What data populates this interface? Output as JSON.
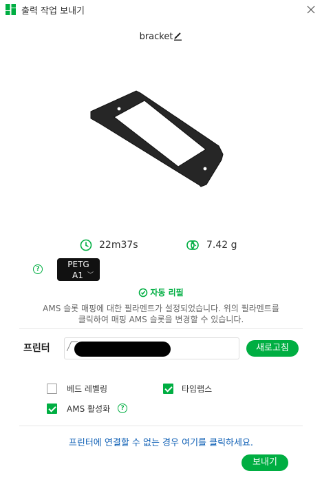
{
  "window": {
    "title": "출력 작업 보내기"
  },
  "model": {
    "name": "bracket"
  },
  "stats": {
    "time": "22m37s",
    "weight": "7.42 g"
  },
  "filament": {
    "type": "PETG",
    "slot": "A1",
    "color": "#111111"
  },
  "auto_refill": {
    "label": "자동 리필"
  },
  "ams_info": {
    "line1": "AMS 슬롯 매핑에 대한 필라멘트가 설정되었습니다. 위의 필라멘트를",
    "line2": "클릭하여 매핑 AMS 슬롯을 변경할 수 있습니다."
  },
  "printer": {
    "label": "프린터",
    "refresh_label": "새로고침"
  },
  "options": {
    "bed_leveling": {
      "label": "베드 레벨링",
      "checked": false
    },
    "timelapse": {
      "label": "타임랩스",
      "checked": true
    },
    "ams": {
      "label": "AMS 활성화",
      "checked": true
    }
  },
  "connect_link": "프린터에 연결할 수 없는 경우 여기를 클릭하세요.",
  "send_label": "보내기",
  "colors": {
    "accent": "#00ae42",
    "link": "#0e5fb5"
  }
}
